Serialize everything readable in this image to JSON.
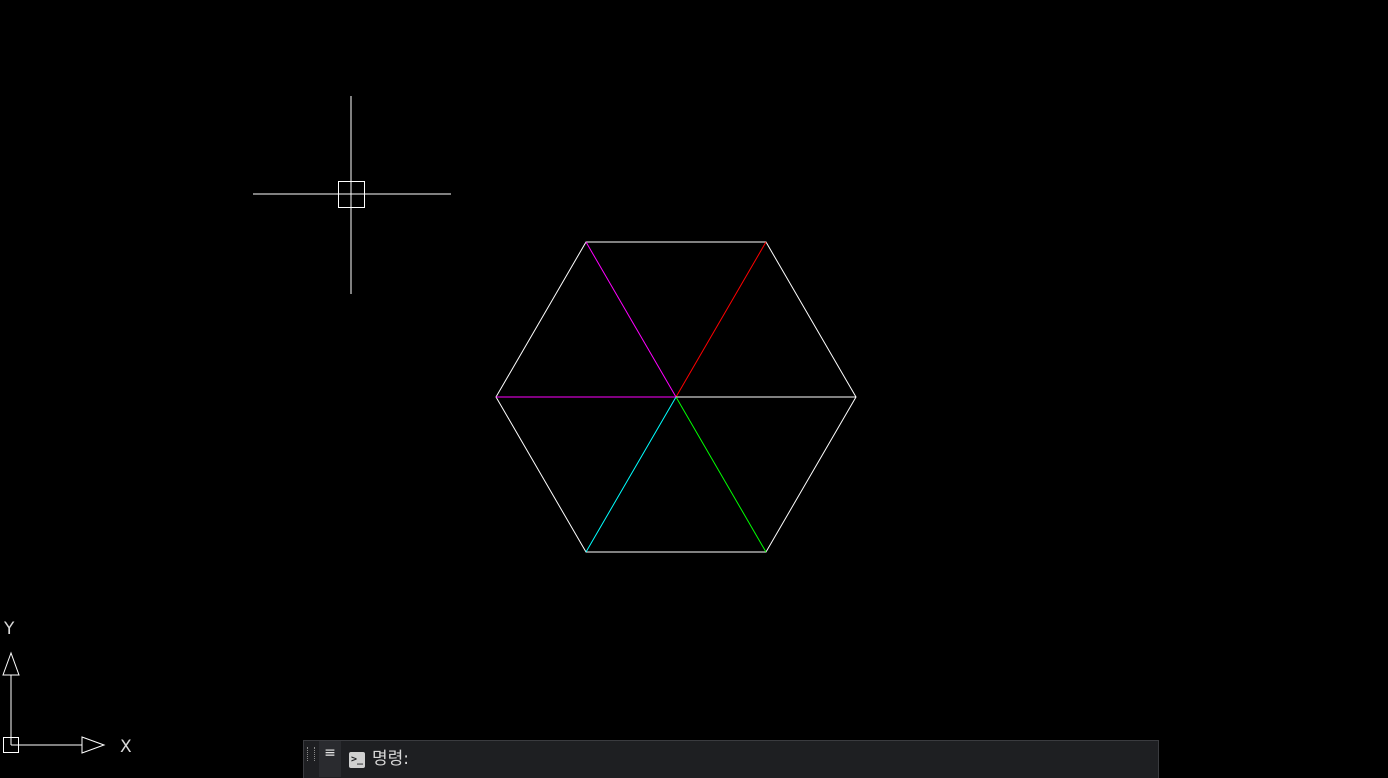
{
  "ucs": {
    "x_label": "X",
    "y_label": "Y"
  },
  "drawing": {
    "outline_color": "#ffffff",
    "spoke_colors": {
      "top_left": "#ff00ff",
      "top_right": "#ff0000",
      "right": "#ffffff",
      "bottom_right": "#00ff00",
      "bottom_left": "#00ffff",
      "left": "#ff00ff"
    }
  },
  "cursor": {
    "icon": "crosshair-cursor-icon",
    "color": "#ffffff"
  },
  "command_line": {
    "menu_icon": "hamburger-menu-icon",
    "menu_glyph": "≡",
    "prompt_icon": "command-prompt-icon",
    "prompt_glyph": ">_",
    "prompt_label": "명령:",
    "input_value": ""
  }
}
